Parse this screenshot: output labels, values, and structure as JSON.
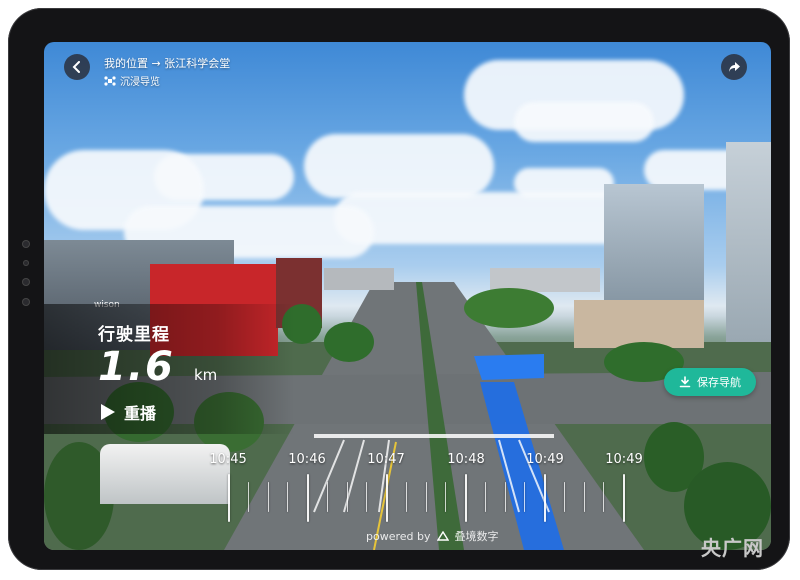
{
  "header": {
    "route_text": "我的位置 → 张江科学会堂",
    "mode_label": "沉浸导览"
  },
  "info": {
    "distance_label": "行驶里程",
    "distance_value": "1.6",
    "distance_unit": "km",
    "replay_label": "重播"
  },
  "actions": {
    "save_label": "保存导航"
  },
  "timeline": {
    "labels": [
      "10:45",
      "10:46",
      "10:47",
      "10:48",
      "10:49",
      "10:49"
    ]
  },
  "scene": {
    "building_sign": "wison"
  },
  "footer": {
    "powered_text": "powered by",
    "brand_text": "叠境数字"
  },
  "watermark": "央广网",
  "colors": {
    "accent": "#1fb89a",
    "route_blue": "#1f6ee6"
  }
}
